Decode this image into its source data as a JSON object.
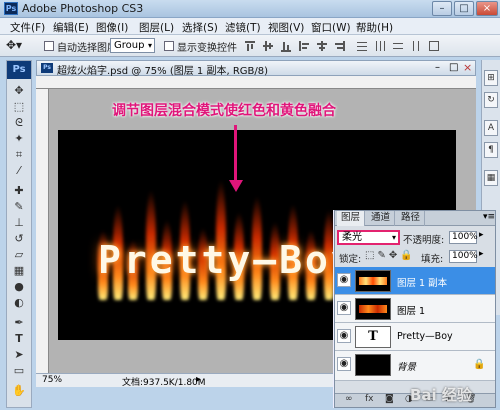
{
  "window": {
    "title": "Adobe Photoshop CS3",
    "app_icon": "Ps",
    "controls": {
      "minimize": "–",
      "maximize": "□",
      "close": "×"
    }
  },
  "menubar": {
    "items": [
      "文件(F)",
      "编辑(E)",
      "图像(I)",
      "图层(L)",
      "选择(S)",
      "滤镜(T)",
      "视图(V)",
      "窗口(W)",
      "帮助(H)"
    ]
  },
  "options": {
    "auto_select_label": "自动选择图层",
    "auto_select_value": "Group",
    "show_transform_label": "显示变换控件"
  },
  "toolbox": {
    "logo": "Ps",
    "tools": [
      "move-tool-icon",
      "marquee-tool-icon",
      "lasso-tool-icon",
      "magic-wand-tool-icon",
      "crop-tool-icon",
      "eyedropper-tool-icon",
      "healing-brush-icon",
      "brush-tool-icon",
      "clone-stamp-icon",
      "history-brush-icon",
      "eraser-tool-icon",
      "gradient-tool-icon",
      "blur-tool-icon",
      "dodge-tool-icon",
      "pen-tool-icon",
      "type-tool-icon",
      "path-select-icon",
      "shape-tool-icon",
      "notes-tool-icon",
      "hand-tool-icon",
      "zoom-tool-icon"
    ]
  },
  "document": {
    "title": "超炫火焰字.psd @ 75% (图层 1 副本, RGB/8)",
    "canvas_text": "Pretty—Boy",
    "annotation": "调节图层混合模式使红色和黄色融合",
    "zoom": "75%",
    "doc_size": "文档:937.5K/1.80M"
  },
  "layers_panel": {
    "tabs": [
      "图层",
      "通道",
      "路径"
    ],
    "blend_mode": "柔光",
    "opacity_label": "不透明度:",
    "opacity_value": "100%",
    "lock_label": "锁定:",
    "fill_label": "填充:",
    "fill_value": "100%",
    "layers": [
      {
        "name": "图层 1 副本",
        "selected": true
      },
      {
        "name": "图层 1",
        "selected": false
      },
      {
        "name": "Pretty—Boy",
        "thumb_text": "T",
        "selected": false
      },
      {
        "name": "背景",
        "selected": false
      }
    ]
  },
  "watermark": "Bai 经验",
  "colors": {
    "accent": "#e0157a",
    "selection": "#3b8ee6"
  }
}
